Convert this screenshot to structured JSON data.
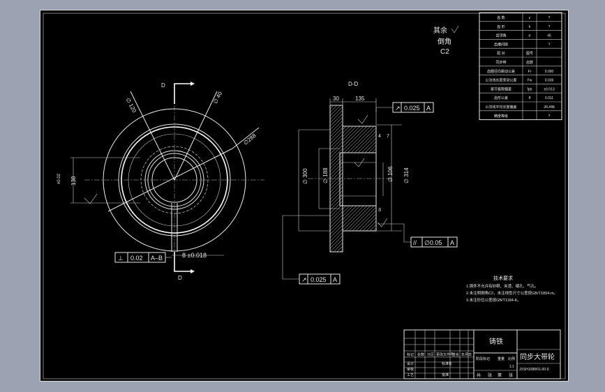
{
  "notes": {
    "roughness_remaining": "其余",
    "chamfer_label": "倒角",
    "chamfer_value": "C2"
  },
  "params": [
    {
      "name": "齿 数",
      "code": "z",
      "value": "?"
    },
    {
      "name": "齿 形",
      "code": "h",
      "value": "?"
    },
    {
      "name": "齿顶角",
      "code": "α",
      "value": "45"
    },
    {
      "name": "齿槽间隙",
      "code": "",
      "value": "?"
    },
    {
      "name": "配 对",
      "code": "图号",
      "value": ""
    },
    {
      "name": "同步带",
      "code": "齿数",
      "value": ""
    },
    {
      "name": "齿圈径向跳动公差",
      "code": "Fr",
      "value": "0.090"
    },
    {
      "name": "公法线长度变动公差",
      "code": "Fw",
      "value": "0.036"
    },
    {
      "name": "基节极限偏差",
      "code": "fpb",
      "value": "±0.013"
    },
    {
      "name": "齿形公差",
      "code": "ff",
      "value": "0.011"
    },
    {
      "name": "公法线平均长度偏差",
      "code": "",
      "value": "34.448"
    },
    {
      "name": "精度等级",
      "code": "",
      "value": "?"
    }
  ],
  "front_view": {
    "section_mark_top": "D",
    "section_mark_bottom": "D",
    "angle_a": "∅ 120",
    "angle_b": "∅ 40",
    "dia_label": "∅288",
    "height_dim": "138",
    "height_tol": "±0.02",
    "key_width": "8 ±0.018",
    "flatness_symbol": "⊥",
    "flatness_value": "0.02",
    "flatness_datum": "A–B"
  },
  "section_view": {
    "title": "D-D",
    "dim_30": "30",
    "dim_135": "135",
    "dim_4": "4",
    "dim_7": "7",
    "dim_3": "3",
    "dia_300": "∅ 300",
    "dia_188": "∅ 188",
    "dia_106": "∅ 106",
    "dia_314": "∅ 314",
    "runout_symbol": "↗",
    "runout_value": "0.025",
    "runout_datum": "A",
    "parallel_symbol": "//",
    "parallel_value": "∅0.05",
    "parallel_datum": "A",
    "runout2_symbol": "↗",
    "runout2_value": "0.025",
    "runout2_datum": "A"
  },
  "tech_req": {
    "title": "技术要求",
    "lines": [
      "1.铸件不允许有砂眼、夹渣、缩孔、气孔。",
      "2.未注明倒角C2，未注线性尺寸公差按GB/T1804-m。",
      "3.未注形位公差按GB/T1184-K。"
    ]
  },
  "title_block": {
    "material": "铸铁",
    "part_name": "同步大带轮",
    "drawing_no": "JXSH1088/01-00-9",
    "header_cells": [
      "标记",
      "处数",
      "分区",
      "更改文件号",
      "签名",
      "年月日"
    ],
    "stage_header": [
      "阶段标记",
      "重量",
      "比例"
    ],
    "scale_value": "1:1",
    "row_labels": [
      "设计",
      "审核",
      "工艺"
    ],
    "row_labels_right": [
      "标准化",
      "批准"
    ],
    "sheet_info": [
      "共",
      "张",
      "第",
      "张"
    ]
  }
}
